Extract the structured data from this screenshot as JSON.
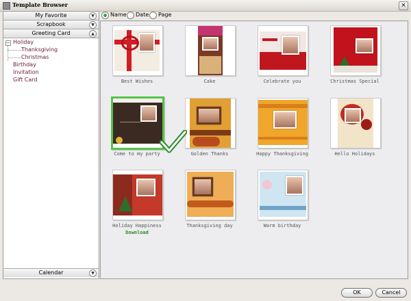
{
  "window": {
    "title": "Template Browser",
    "close_glyph": "×"
  },
  "categories": {
    "top": [
      {
        "label": "My Favorite"
      },
      {
        "label": "Scrapbook"
      },
      {
        "label": "Greeting Card"
      }
    ],
    "bottom": {
      "label": "Calendar"
    }
  },
  "tree": {
    "root": "Holiday",
    "root_toggle": "−",
    "children": [
      "Thanksgiving",
      "Christmas"
    ],
    "siblings": [
      "Birthday",
      "Invitation",
      "Gift Card"
    ]
  },
  "sort": {
    "options": [
      "Name",
      "Date",
      "Page"
    ],
    "selected": "Name"
  },
  "templates": [
    {
      "label": "Best Wishes",
      "icon": "red-ribbon-card"
    },
    {
      "label": "Cake",
      "icon": "brown-cake-card"
    },
    {
      "label": "Celebrate you",
      "icon": "red-birthday-card"
    },
    {
      "label": "Christmas Special",
      "icon": "red-christmas-card"
    },
    {
      "label": "Come to my party",
      "icon": "dark-party-card",
      "selected": true
    },
    {
      "label": "Golden Thanks",
      "icon": "golden-thanks-card"
    },
    {
      "label": "Happy Thanksgiving",
      "icon": "orange-thanksgiving-card"
    },
    {
      "label": "Hello Holidays",
      "icon": "cream-holidays-card"
    },
    {
      "label": "Holiday Happiness",
      "icon": "green-holiday-card",
      "download": "Download"
    },
    {
      "label": "Thanksgiving day",
      "icon": "orange-autumn-card"
    },
    {
      "label": "Warm birthday",
      "icon": "blue-birthday-card"
    }
  ],
  "buttons": {
    "ok": "OK",
    "cancel": "Cancel"
  },
  "colors": {
    "selection": "#55c44a",
    "tree_text": "#6a1a39",
    "download_text": "#2f8a22"
  }
}
